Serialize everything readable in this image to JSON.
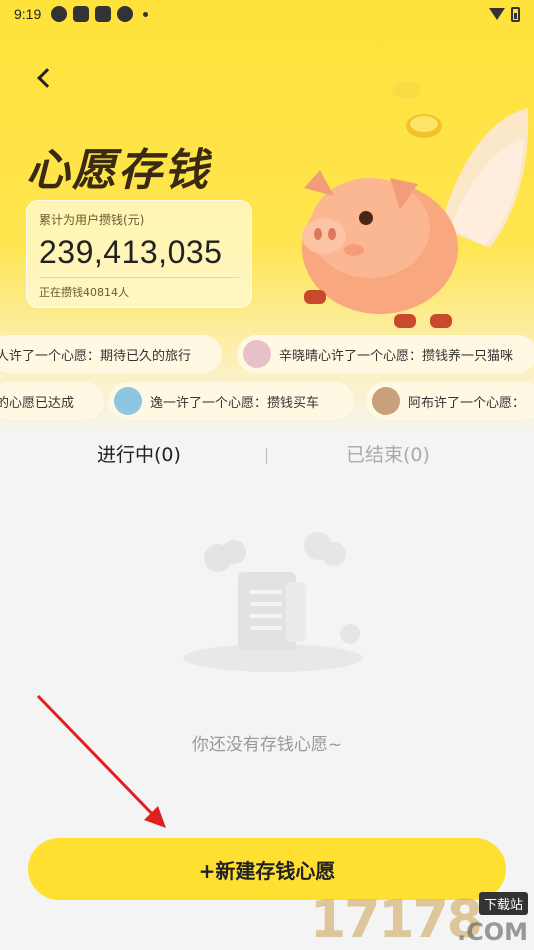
{
  "status_bar": {
    "time": "9:19"
  },
  "header": {
    "title": "心愿存钱"
  },
  "stats": {
    "label": "累计为用户攒钱(元)",
    "total": "239,413,035",
    "participants": "正在攒钱40814人"
  },
  "ticker": {
    "row1": [
      {
        "text": "人许了一个心愿：期待已久的旅行"
      },
      {
        "text": "辛晓晴心许了一个心愿：攒钱养一只猫咪"
      }
    ],
    "row2": [
      {
        "text": "的心愿已达成"
      },
      {
        "text": "逸一许了一个心愿：攒钱买车"
      },
      {
        "text": "阿布许了一个心愿："
      }
    ]
  },
  "tabs": {
    "active": "进行中(0)",
    "inactive": "已结束(0)"
  },
  "empty_state": {
    "text": "你还没有存钱心愿~"
  },
  "action": {
    "new_wish_label": "+新建存钱心愿"
  },
  "watermark": {
    "number": "17178",
    "tag": "下载站",
    "suffix": ".COM"
  },
  "colors": {
    "accent": "#ffdf30",
    "title": "#3a2a14",
    "annotation_arrow": "#e02020"
  }
}
